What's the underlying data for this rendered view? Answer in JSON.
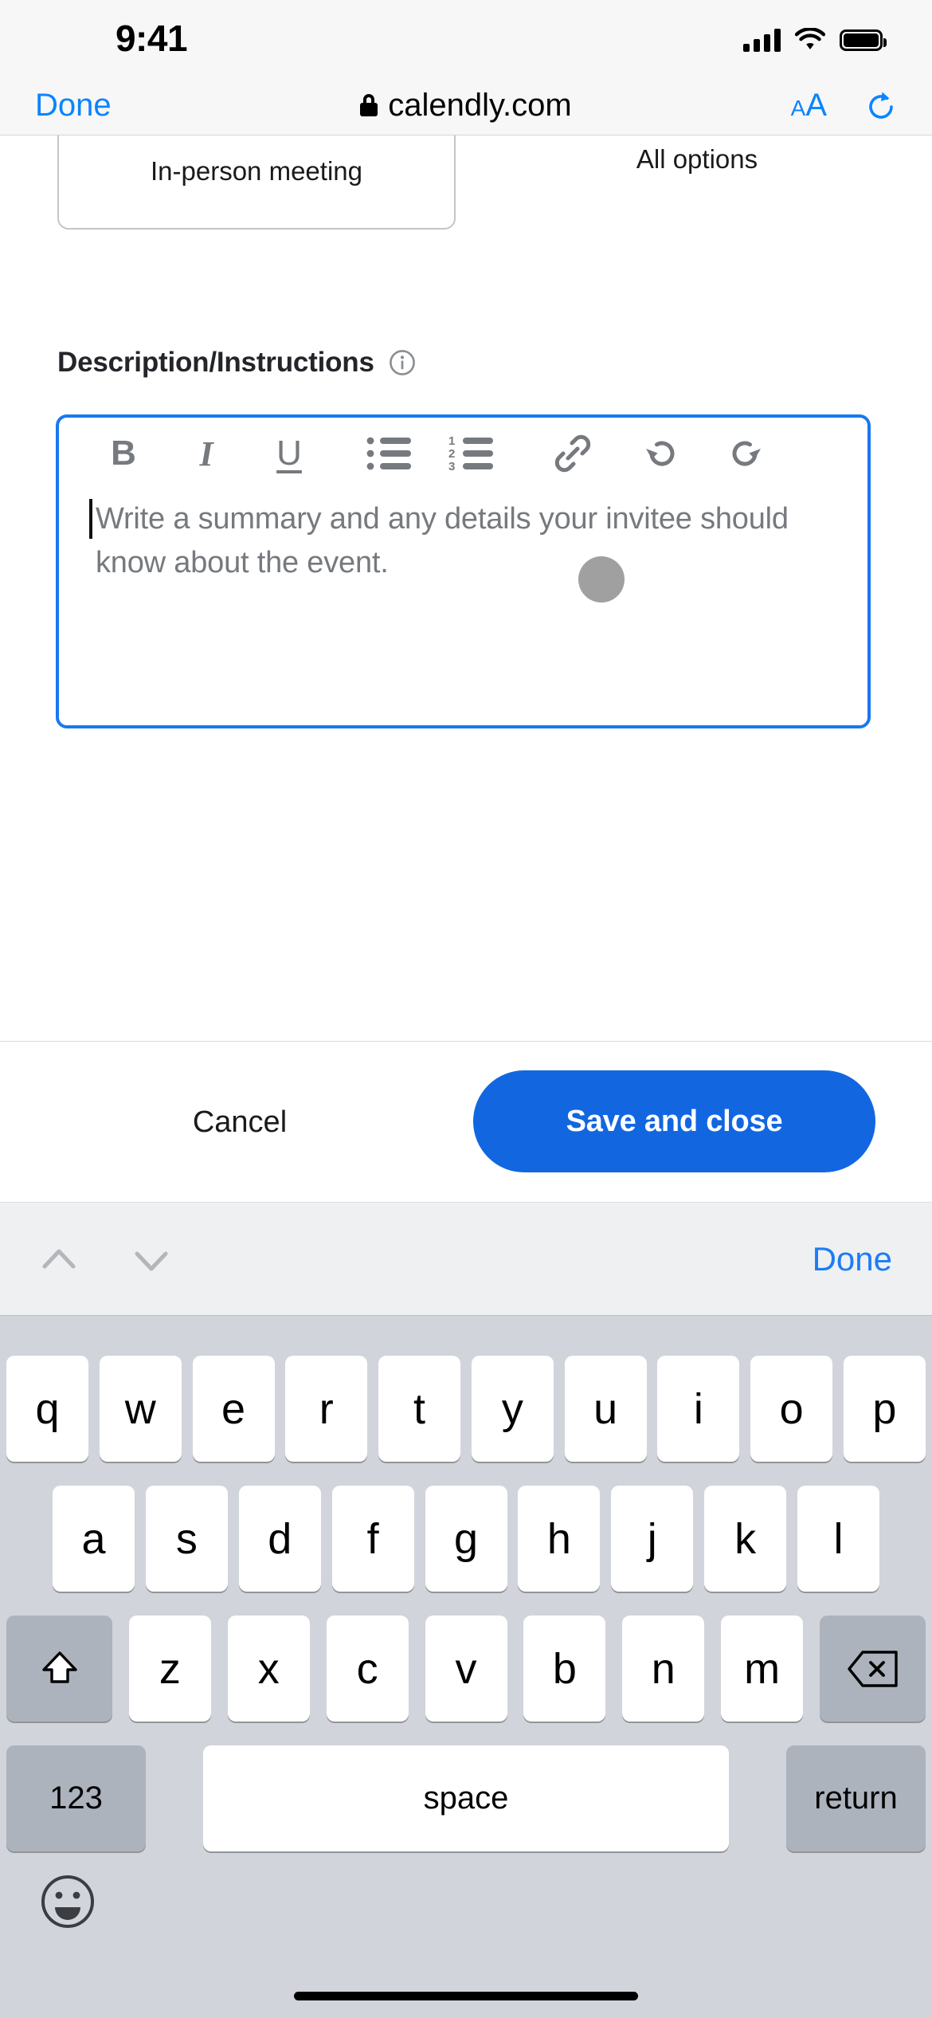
{
  "status_bar": {
    "time": "9:41",
    "signal_icon": "cellular-signal-icon",
    "wifi_icon": "wifi-icon",
    "battery_icon": "battery-icon"
  },
  "browser": {
    "done_label": "Done",
    "url": "calendly.com",
    "lock_icon": "lock-icon",
    "text_size_small": "A",
    "text_size_large": "A",
    "reload_icon": "reload-icon",
    "accent_color": "#0a84ff"
  },
  "page": {
    "location_card_label": "In-person meeting",
    "all_options_label": "All options",
    "field_label": "Description/Instructions",
    "info_icon": "info-circle-icon",
    "editor": {
      "placeholder": "Write a summary and any details your invitee should know about the event.",
      "focus_color": "#1978f0",
      "toolbar": [
        {
          "name": "bold-icon",
          "glyph": "B"
        },
        {
          "name": "italic-icon",
          "glyph": "I"
        },
        {
          "name": "underline-icon",
          "glyph": "U"
        },
        {
          "name": "bulleted-list-icon",
          "glyph": ""
        },
        {
          "name": "numbered-list-icon",
          "glyph": ""
        },
        {
          "name": "link-icon",
          "glyph": ""
        },
        {
          "name": "undo-icon",
          "glyph": ""
        },
        {
          "name": "redo-icon",
          "glyph": ""
        }
      ]
    }
  },
  "action_bar": {
    "cancel_label": "Cancel",
    "save_label": "Save and close",
    "save_color": "#1267e0"
  },
  "keyboard_accessory": {
    "prev_icon": "chevron-up-icon",
    "next_icon": "chevron-down-icon",
    "done_label": "Done",
    "done_color": "#1c7cf5"
  },
  "keyboard": {
    "row1": [
      "q",
      "w",
      "e",
      "r",
      "t",
      "y",
      "u",
      "i",
      "o",
      "p"
    ],
    "row2": [
      "a",
      "s",
      "d",
      "f",
      "g",
      "h",
      "j",
      "k",
      "l"
    ],
    "row3": [
      "z",
      "x",
      "c",
      "v",
      "b",
      "n",
      "m"
    ],
    "shift_icon": "shift-icon",
    "backspace_icon": "backspace-icon",
    "numbers_label": "123",
    "space_label": "space",
    "return_label": "return",
    "emoji_icon": "emoji-smiley-icon"
  }
}
